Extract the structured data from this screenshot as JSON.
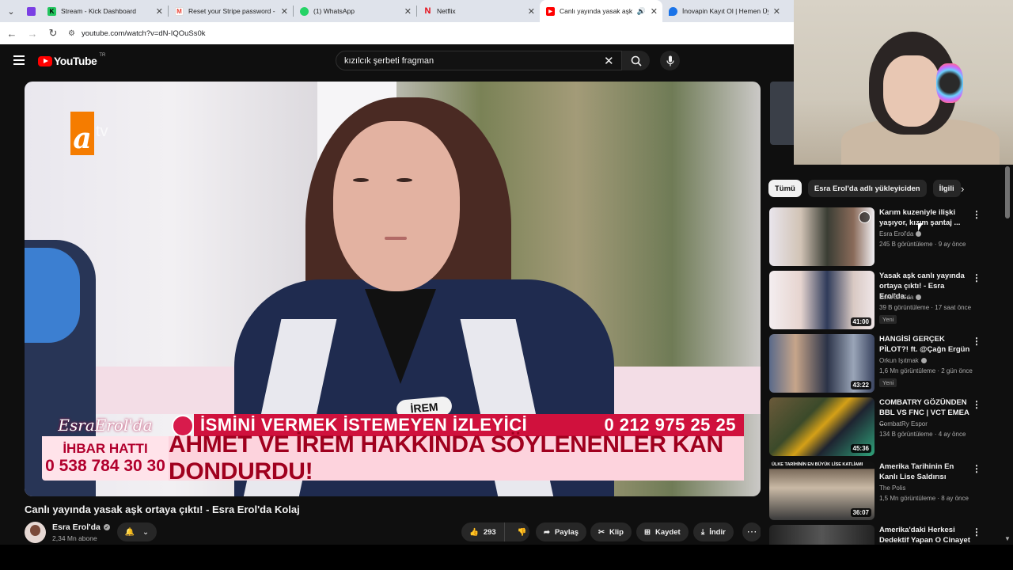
{
  "browser": {
    "tabs": [
      {
        "title": "",
        "color": "#7b3fe4",
        "glyph": ""
      },
      {
        "title": "Stream - Kick Dashboard",
        "color": "#22c55e",
        "glyph": "K"
      },
      {
        "title": "Reset your Stripe password - n",
        "color": "#ea4335",
        "glyph": "M"
      },
      {
        "title": "(1) WhatsApp",
        "color": "#25d366",
        "glyph": "◉"
      },
      {
        "title": "Netflix",
        "color": "#e50914",
        "glyph": "N"
      },
      {
        "title": "Canlı yayında yasak aşk orta",
        "color": "#ff0000",
        "glyph": "▶",
        "active": true
      },
      {
        "title": "İnovapin Kayıt Ol | Hemen Üye",
        "color": "#1a73e8",
        "glyph": "◆"
      }
    ],
    "url": "youtube.com/watch?v=dN-IQOuSs0k"
  },
  "header": {
    "logo_text": "YouTube",
    "country_code": "TR",
    "search_value": "kızılcık şerbeti fragman"
  },
  "player": {
    "channel_logo_a": "a",
    "channel_logo_tv": "tv",
    "lower_third": {
      "show_logo": "EsraErol'da",
      "caller_name": "İSMİNİ VERMEK İSTEMEYEN İZLEYİCİ",
      "caller_phone": "0 212 975 25 25",
      "hotline_label": "İHBAR HATTI",
      "hotline_number": "0 538 784 30 30",
      "headline": "AHMET VE İREM HAKKINDA SÖYLENENLER KAN DONDURDU!"
    },
    "name_tag": "İREM"
  },
  "video": {
    "title": "Canlı yayında yasak aşk ortaya çıktı! - Esra Erol'da Kolaj",
    "channel": "Esra Erol'da",
    "subscribers": "2,34 Mn abone",
    "like_count": "293",
    "share_label": "Paylaş",
    "clip_label": "Klip",
    "save_label": "Kaydet",
    "download_label": "İndir"
  },
  "sidebar": {
    "chips": [
      "Tümü",
      "Esra Erol'da adlı yükleyiciden",
      "İlgili"
    ],
    "recommendations": [
      {
        "title": "Karım kuzeniyle ilişki yaşıyor, kızım şantaj ...",
        "channel": "Esra Erol'da",
        "meta": "245 B görüntüleme · 9 ay önce",
        "duration": "",
        "badge": "",
        "thumb_colors": [
          "#d9d4e0",
          "#8a6b5a"
        ]
      },
      {
        "title": "Yasak aşk canlı yayında ortaya çıktı! - Esra Erol'da...",
        "channel": "Esra Erol'da",
        "meta": "39 B görüntüleme · 17 saat önce",
        "duration": "41:00",
        "badge": "Yeni",
        "thumb_colors": [
          "#f0e9ec",
          "#c2185b"
        ]
      },
      {
        "title": "HANGİSİ GERÇEK PİLOT?! ft. @Çağn Ergün",
        "channel": "Orkun Işıtmak",
        "meta": "1,6 Mn görüntüleme · 2 gün önce",
        "duration": "43:22",
        "badge": "Yeni",
        "thumb_colors": [
          "#4a5a7a",
          "#1e2a40"
        ]
      },
      {
        "title": "COMBATRY GÖZÜNDEN BBL VS FNC | VCT EMEA ...",
        "channel": "CombatRy Espor",
        "meta": "134 B görüntüleme · 4 ay önce",
        "duration": "45:36",
        "badge": "",
        "thumb_colors": [
          "#3b4a2a",
          "#d4a017"
        ]
      },
      {
        "title": "Amerika Tarihinin En Kanlı Lise Saldırısı",
        "channel": "The Polis",
        "meta": "1,5 Mn görüntüleme · 8 ay önce",
        "duration": "36:07",
        "badge": "",
        "thumb_colors": [
          "#2a2a2a",
          "#6b5a4a"
        ],
        "banner": "ÜLKE TARİHİNİN EN BÜYÜK LİSE KATLİAMI"
      },
      {
        "title": "Amerika'daki Herkesi Dedektif Yapan O Cinayet",
        "channel": "",
        "meta": "",
        "duration": "",
        "badge": "",
        "thumb_colors": [
          "#1a1a1a",
          "#555555"
        ]
      }
    ]
  }
}
